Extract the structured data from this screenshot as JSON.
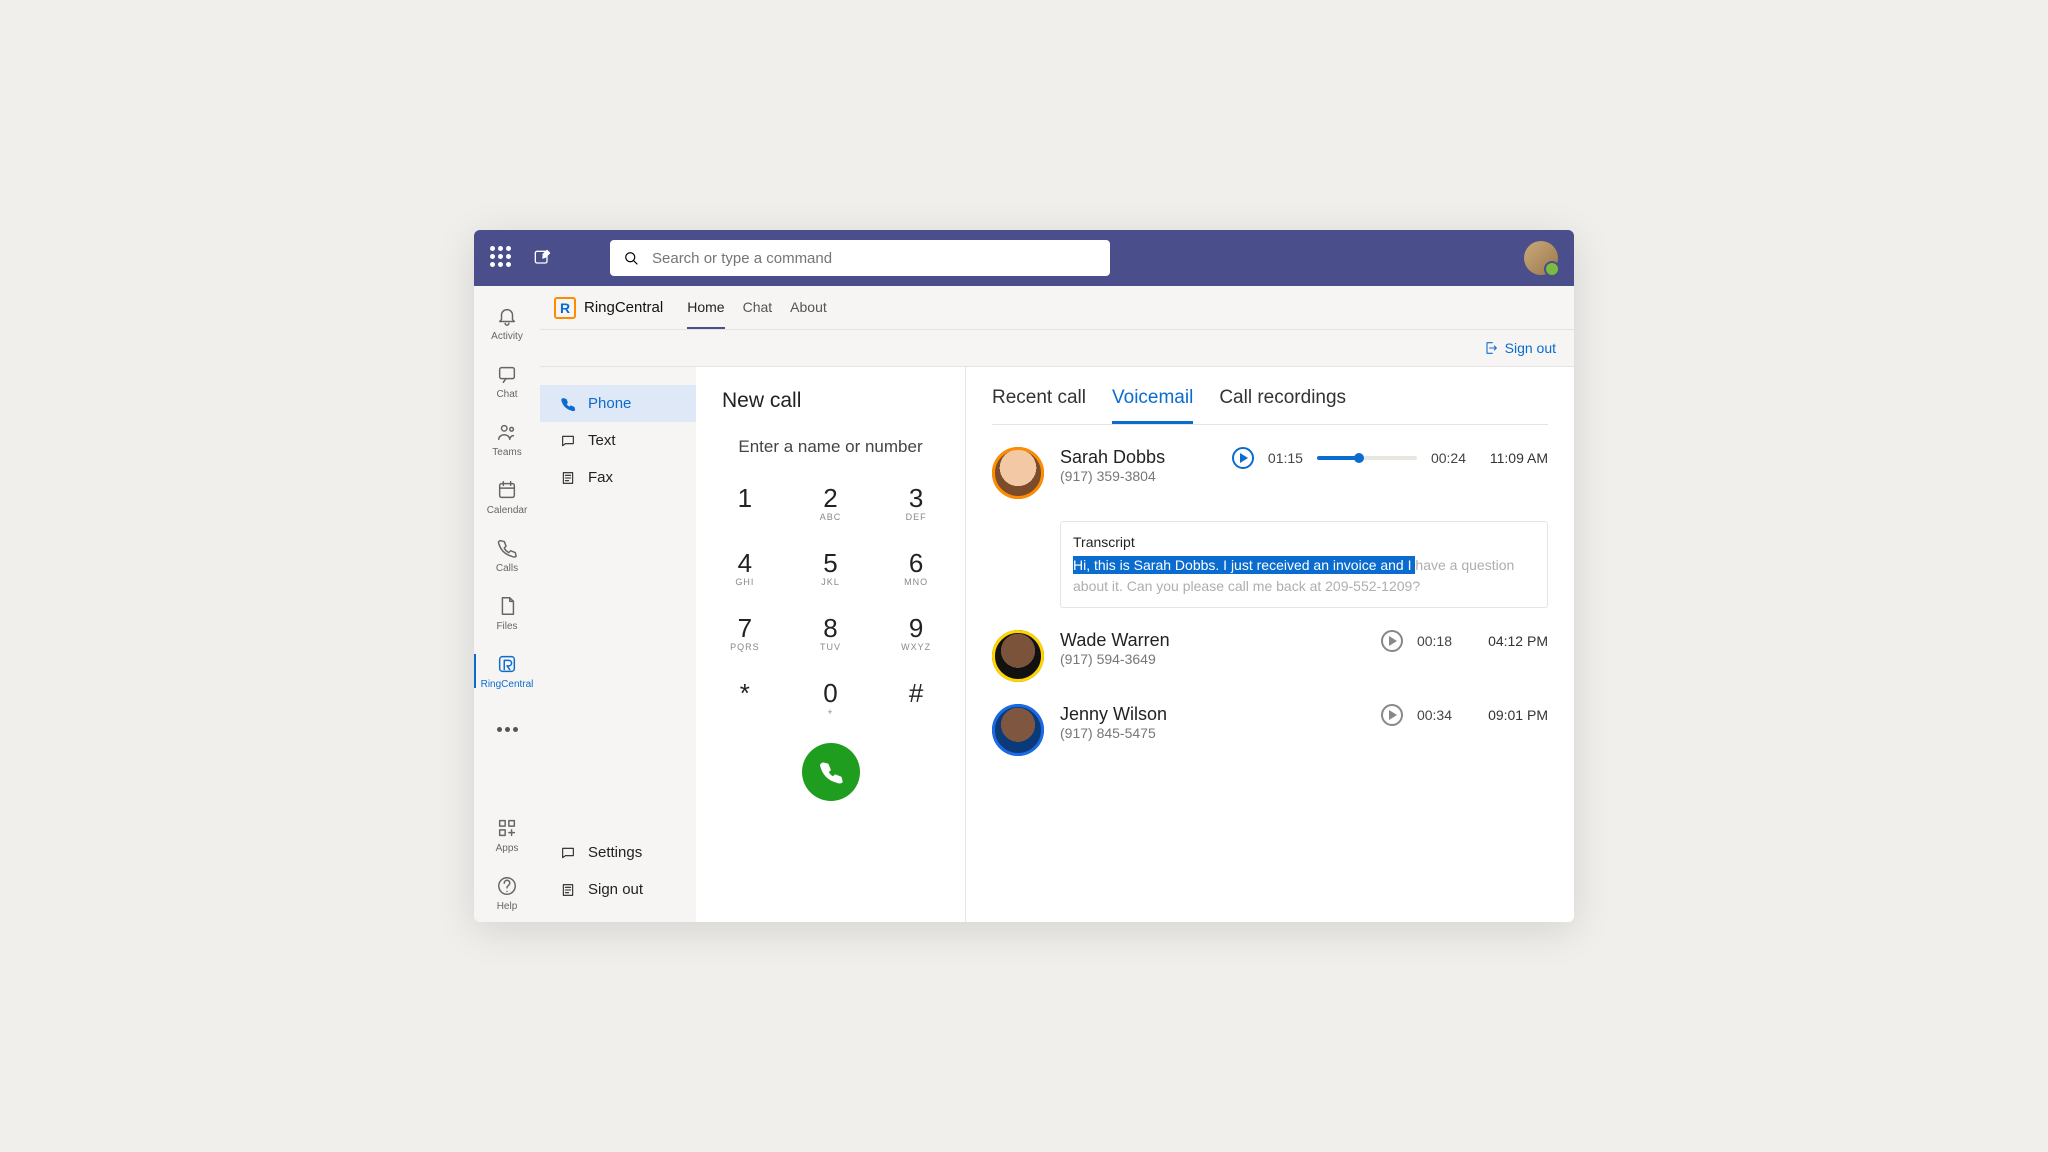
{
  "topbar": {
    "search_placeholder": "Search or type a command"
  },
  "rail": [
    {
      "id": "activity",
      "label": "Activity"
    },
    {
      "id": "chat",
      "label": "Chat"
    },
    {
      "id": "teams",
      "label": "Teams"
    },
    {
      "id": "calendar",
      "label": "Calendar"
    },
    {
      "id": "calls",
      "label": "Calls"
    },
    {
      "id": "files",
      "label": "Files"
    },
    {
      "id": "ringcentral",
      "label": "RingCentral"
    }
  ],
  "rail_bottom": [
    {
      "id": "apps",
      "label": "Apps"
    },
    {
      "id": "help",
      "label": "Help"
    }
  ],
  "app": {
    "title": "RingCentral",
    "tabs": [
      "Home",
      "Chat",
      "About"
    ],
    "sign_out": "Sign out"
  },
  "nav": {
    "items": [
      "Phone",
      "Text",
      "Fax"
    ],
    "settings": "Settings",
    "sign_out": "Sign out"
  },
  "dial": {
    "title": "New call",
    "placeholder": "Enter a name or number",
    "keys": [
      {
        "n": "1",
        "l": ""
      },
      {
        "n": "2",
        "l": "ABC"
      },
      {
        "n": "3",
        "l": "DEF"
      },
      {
        "n": "4",
        "l": "GHI"
      },
      {
        "n": "5",
        "l": "JKL"
      },
      {
        "n": "6",
        "l": "MNO"
      },
      {
        "n": "7",
        "l": "PQRS"
      },
      {
        "n": "8",
        "l": "TUV"
      },
      {
        "n": "9",
        "l": "WXYZ"
      },
      {
        "n": "*",
        "l": ""
      },
      {
        "n": "0",
        "l": "+"
      },
      {
        "n": "#",
        "l": ""
      }
    ]
  },
  "main_tabs": [
    "Recent call",
    "Voicemail",
    "Call recordings"
  ],
  "voicemails": [
    {
      "name": "Sarah Dobbs",
      "phone": "(917) 359-3804",
      "elapsed": "01:15",
      "total": "00:24",
      "time": "11:09 AM",
      "progress_pct": 42,
      "transcript_heading": "Transcript",
      "transcript_sel": "Hi, this is Sarah Dobbs. I just received an invoice and I ",
      "transcript_rest": "have a question about it. Can you please call me back at 209-552-1209?"
    },
    {
      "name": "Wade Warren",
      "phone": "(917) 594-3649",
      "elapsed": "00:18",
      "time": "04:12 PM"
    },
    {
      "name": "Jenny Wilson",
      "phone": "(917) 845-5475",
      "elapsed": "00:34",
      "time": "09:01 PM"
    }
  ]
}
